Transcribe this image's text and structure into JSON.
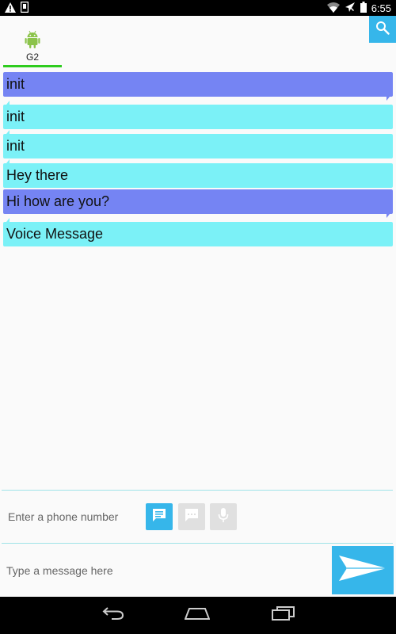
{
  "status_bar": {
    "time": "6:55",
    "icons": [
      "warning-icon",
      "phone-storage-icon",
      "wifi-icon",
      "airplane-icon",
      "battery-icon"
    ]
  },
  "header": {
    "contact_name": "G2",
    "contact_icon": "android-icon",
    "tab_indicator_color": "#2ecc1e",
    "search_icon": "search-icon"
  },
  "messages": [
    {
      "text": "init",
      "type": "sent"
    },
    {
      "text": "init",
      "type": "received"
    },
    {
      "text": "init",
      "type": "received"
    },
    {
      "text": "Hey there",
      "type": "received"
    },
    {
      "text": "Hi how are you?",
      "type": "sent"
    },
    {
      "text": "Voice Message",
      "type": "received"
    }
  ],
  "composer": {
    "phone_placeholder": "Enter a phone number",
    "message_placeholder": "Type a message here",
    "mode_buttons": [
      {
        "icon": "chat-bubble-icon",
        "state": "active"
      },
      {
        "icon": "message-icon",
        "state": "inactive"
      },
      {
        "icon": "microphone-icon",
        "state": "inactive"
      }
    ],
    "send_icon": "send-arrow-icon"
  },
  "nav_bar": {
    "icons": [
      "back-icon",
      "home-icon",
      "recents-icon"
    ]
  },
  "colors": {
    "sent_bubble": "#7584f3",
    "received_bubble": "#7bf1f7",
    "accent": "#36b6ea"
  }
}
